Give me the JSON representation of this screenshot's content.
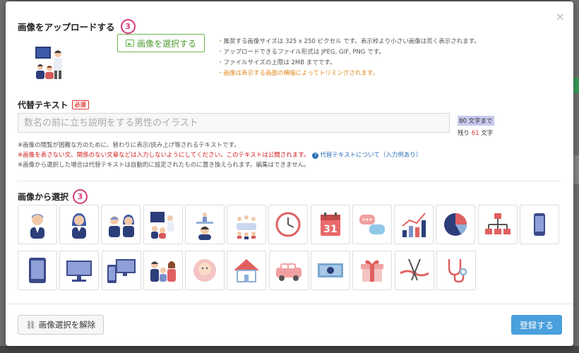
{
  "colors": {
    "accent_pink": "#d63a7a",
    "green": "#6cb64a",
    "primary_blue": "#4aa0dc",
    "red": "#d02020",
    "orange": "#e08a1e"
  },
  "upload": {
    "title": "画像をアップロードする",
    "step": "3",
    "select_button": "画像を選択する",
    "notes": [
      "推奨する画像サイズは 325 x 250 ピクセル です。表示枠より小さい画像は荒く表示されます。",
      "アップロードできるファイル形式は JPEG, GIF, PNG です。",
      "ファイルサイズの上限は 2MB までです。",
      "画像は表示する画面の横幅によってトリミングされます。"
    ]
  },
  "alt": {
    "label": "代替テキスト",
    "required": "必須",
    "placeholder": "数名の前に立ち説明をする男性のイラスト",
    "limit": "80 文字まで",
    "remain_prefix": "残り ",
    "remain_count": "61",
    "remain_suffix": " 文字",
    "note1": "※画像の閲覧が困難な方のために、替わりに表示/読み上げ等されるテキストです。",
    "note2": "※画像を表さない文、関係のない文章などは入力しないようにしてください。このテキストは公開されます。",
    "help_link": "代替テキストについて（入力例あり）",
    "note3": "※画像から選択した場合は代替テキストは自動的に設定されたものに置き換えられます。編集はできません。"
  },
  "gallery": {
    "title": "画像から選択",
    "step": "3",
    "row1": [
      "man-icon",
      "woman-icon",
      "couple-icon",
      "presenter-icon",
      "speaker-icon",
      "meeting-icon",
      "clock-icon",
      "calendar-icon",
      "chat-icon",
      "growth-chart-icon",
      "pie-chart-icon",
      "org-chart-icon",
      "smartphone-icon"
    ],
    "row2": [
      "tablet-icon",
      "monitor-icon",
      "devices-icon",
      "family-icon",
      "baby-icon",
      "house-icon",
      "car-icon",
      "money-icon",
      "gift-icon",
      "scissors-ribbon-icon",
      "stethoscope-icon"
    ],
    "calendar_day": "31"
  },
  "footer": {
    "clear_button": "画像選択を解除",
    "submit_button": "登録する"
  },
  "close_label": "×"
}
